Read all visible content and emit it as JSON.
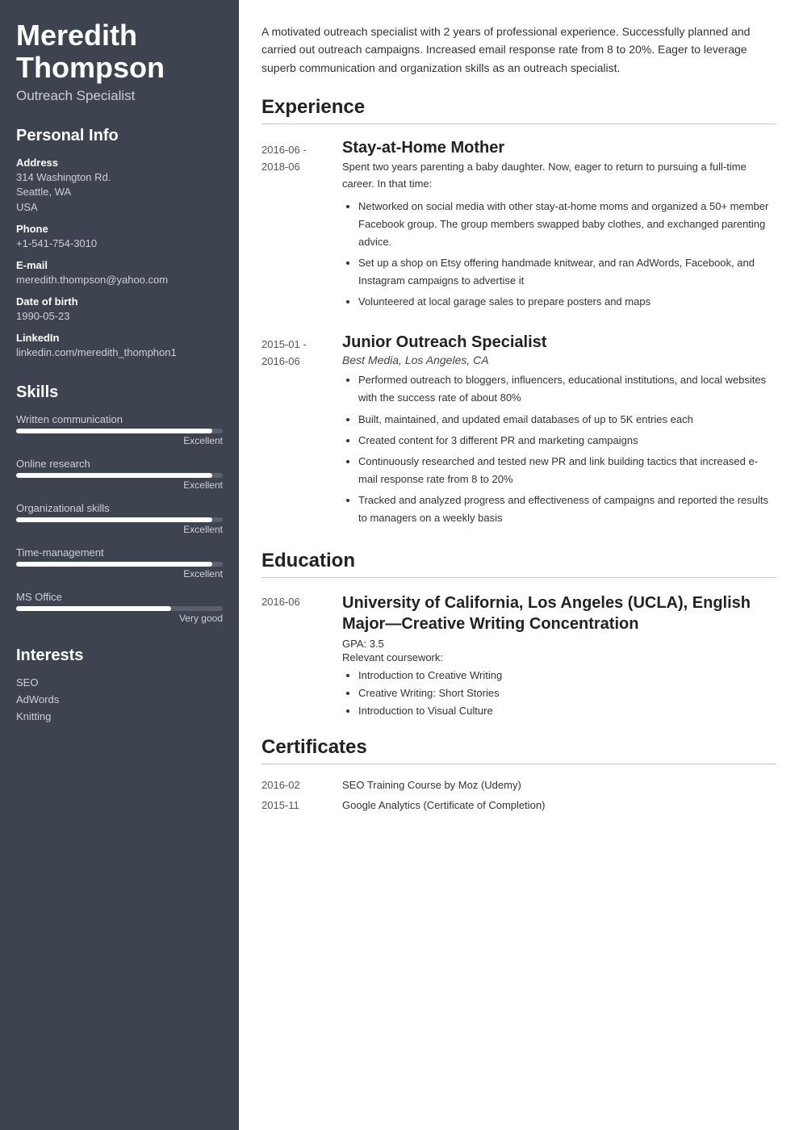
{
  "sidebar": {
    "name": "Meredith Thompson",
    "title": "Outreach Specialist",
    "personal_info": {
      "label": "Personal Info",
      "fields": [
        {
          "label": "Address",
          "values": [
            "314 Washington Rd.",
            "Seattle, WA",
            "USA"
          ]
        },
        {
          "label": "Phone",
          "values": [
            "+1-541-754-3010"
          ]
        },
        {
          "label": "E-mail",
          "values": [
            "meredith.thompson@yahoo.com"
          ]
        },
        {
          "label": "Date of birth",
          "values": [
            "1990-05-23"
          ]
        },
        {
          "label": "LinkedIn",
          "values": [
            "linkedin.com/meredith_thomphon1"
          ]
        }
      ]
    },
    "skills": {
      "label": "Skills",
      "items": [
        {
          "name": "Written communication",
          "level": "Excellent",
          "pct": 95
        },
        {
          "name": "Online research",
          "level": "Excellent",
          "pct": 95
        },
        {
          "name": "Organizational skills",
          "level": "Excellent",
          "pct": 95
        },
        {
          "name": "Time-management",
          "level": "Excellent",
          "pct": 95
        },
        {
          "name": "MS Office",
          "level": "Very good",
          "pct": 75
        }
      ]
    },
    "interests": {
      "label": "Interests",
      "items": [
        "SEO",
        "AdWords",
        "Knitting"
      ]
    }
  },
  "main": {
    "summary": "A motivated outreach specialist with 2 years of professional experience. Successfully planned and carried out outreach campaigns. Increased email response rate from 8 to 20%. Eager to leverage superb communication and organization skills as an outreach specialist.",
    "experience": {
      "label": "Experience",
      "items": [
        {
          "date_start": "2016-06 -",
          "date_end": "2018-06",
          "title": "Stay-at-Home Mother",
          "company": "",
          "description": "Spent two years parenting a baby daughter. Now, eager to return to pursuing a full-time career. In that time:",
          "bullets": [
            "Networked on social media with other stay-at-home moms and organized a 50+ member Facebook group. The group members swapped baby clothes, and exchanged parenting advice.",
            "Set up a shop on Etsy offering handmade knitwear, and ran AdWords, Facebook, and Instagram campaigns to advertise it",
            "Volunteered at local garage sales to prepare posters and maps"
          ]
        },
        {
          "date_start": "2015-01 -",
          "date_end": "2016-06",
          "title": "Junior Outreach Specialist",
          "company": "Best Media, Los Angeles, CA",
          "description": "",
          "bullets": [
            "Performed outreach to bloggers, influencers, educational institutions, and local websites with the success rate of about 80%",
            "Built, maintained, and updated email databases of up to 5K entries each",
            "Created content for 3 different PR and marketing campaigns",
            "Continuously researched and tested new PR and link building tactics that increased e-mail response rate from 8 to 20%",
            "Tracked and analyzed progress and effectiveness of campaigns and reported the results to managers on a weekly basis"
          ]
        }
      ]
    },
    "education": {
      "label": "Education",
      "items": [
        {
          "date": "2016-06",
          "title": "University of California, Los Angeles (UCLA), English Major—Creative Writing Concentration",
          "gpa": "GPA: 3.5",
          "coursework_label": "Relevant coursework:",
          "coursework": [
            "Introduction to Creative Writing",
            "Creative Writing: Short Stories",
            "Introduction to Visual Culture"
          ]
        }
      ]
    },
    "certificates": {
      "label": "Certificates",
      "items": [
        {
          "date": "2016-02",
          "name": "SEO Training Course by Moz (Udemy)"
        },
        {
          "date": "2015-11",
          "name": "Google Analytics (Certificate of Completion)"
        }
      ]
    }
  }
}
